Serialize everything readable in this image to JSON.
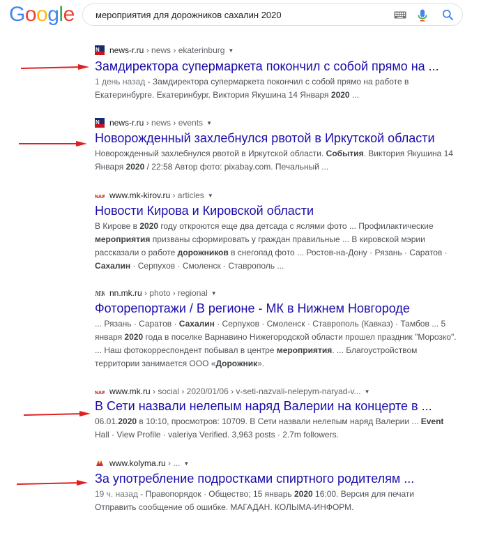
{
  "logo": {
    "letters": [
      "G",
      "o",
      "o",
      "g",
      "l",
      "e"
    ],
    "colors": [
      "#4285f4",
      "#ea4335",
      "#fbbc05",
      "#4285f4",
      "#34a853",
      "#ea4335"
    ]
  },
  "search": {
    "query": "мероприятия для дорожников сахалин 2020"
  },
  "icons": {
    "keyboard": "keyboard-icon",
    "mic": "mic-icon",
    "search": "search-icon"
  },
  "results": [
    {
      "site": "news-r.ru",
      "path": " › news › ekaterinburg",
      "title": "Замдиректора супермаркета покончил с собой прямо на ...",
      "snippet_html": "<span class=\"date\">1 день назад</span> - Замдиректора супермаркета покончил с собой прямо на работе в Екатеринбурге. Екатеринбург. Виктория Якушина 14 Января <b>2020</b> ..."
    },
    {
      "site": "news-r.ru",
      "path": " › news › events",
      "title": "Новорожденный захлебнулся рвотой в Иркутской области",
      "snippet_html": "Новорожденный захлебнулся рвотой в Иркутской области. <b>События</b>. Виктория Якушина 14 Января <b>2020</b> / 22:58 Автор фото: pixabay.com. Печальный ..."
    },
    {
      "site": "www.mk-kirov.ru",
      "path": " › articles",
      "title": "Новости Кирова и Кировской области",
      "snippet_html": "В Кирове в <b>2020</b> году откроются еще два детсада с яслями фото ... Профилактические <b>мероприятия</b> призваны сформировать у граждан правильные ... В кировской мэрии рассказали о работе <b>дорожников</b> в снегопад фото ... Ростов-на-Дону · Рязань · Саратов · <b>Сахалин</b> · Серпухов · Смоленск · Ставрополь ..."
    },
    {
      "site": "nn.mk.ru",
      "path": " › photo › regional",
      "title": "Фоторепортажи / В регионе - МК в Нижнем Новгороде",
      "snippet_html": "... Рязань · Саратов · <b>Сахалин</b> · Серпухов · Смоленск · Ставрополь (Кавказ) · Тамбов ... 5 января <b>2020</b> года в поселке Варнавино Нижегородской области прошел праздник \"Морозко\". ... Наш фотокорреспондент побывал в центре <b>мероприятия</b>. ... Благоустройством территории занимается ООО «<b>Дорожник</b>»."
    },
    {
      "site": "www.mk.ru",
      "path": " › social › 2020/01/06 › v-seti-nazvali-nelepym-naryad-v...",
      "title": "В Сети назвали нелепым наряд Валерии на концерте в ...",
      "snippet_html": "06.01.<b>2020</b> в 10:10, просмотров: 10709. В Сети назвали нелепым наряд Валерии ... <b>Event</b> Hall · View Profile · valeriya Verified. 3,963 posts · 2.7m followers."
    },
    {
      "site": "www.kolyma.ru",
      "path": " › ...",
      "title": "За употребление подростками спиртного родителям ...",
      "snippet_html": "<span class=\"date\">19 ч. назад</span> - Правопорядок · Общество; 15 январь <b>2020</b> 16:00. Версия для печати Отправить сообщение об ошибке. МАГАДАН. КОЛЫМА-ИНФОРМ."
    }
  ]
}
